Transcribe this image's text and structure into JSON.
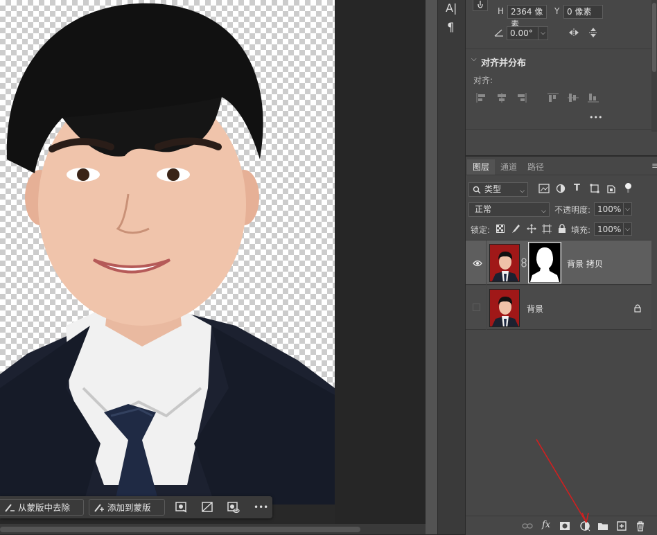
{
  "properties": {
    "h_label": "H",
    "h_value": "2364 像素",
    "y_label": "Y",
    "y_value": "0 像素",
    "angle_value": "0.00°",
    "align_section_title": "对齐并分布",
    "align_label": "对齐:",
    "more": "•••"
  },
  "layers_panel": {
    "tabs": [
      "图层",
      "通道",
      "路径"
    ],
    "filter_kind": "类型",
    "blend_mode": "正常",
    "opacity_label": "不透明度:",
    "opacity_value": "100%",
    "lock_label": "锁定:",
    "fill_label": "填充:",
    "fill_value": "100%",
    "layers": [
      {
        "name": "背景 拷贝",
        "visible": true,
        "has_mask": true,
        "selected": true
      },
      {
        "name": "背景",
        "visible": false,
        "locked": true,
        "selected": false
      }
    ]
  },
  "taskbar": {
    "subtract_label": "从蒙版中去除",
    "add_label": "添加到蒙版",
    "more": "•••"
  },
  "tool_strip": {
    "char_icon": "A|",
    "para_icon": "¶"
  },
  "colors": {
    "panel_bg": "#474747",
    "selected_layer": "#5e5e5e",
    "thumb_red": "#a01818",
    "annotation_arrow": "#d21f1f"
  }
}
